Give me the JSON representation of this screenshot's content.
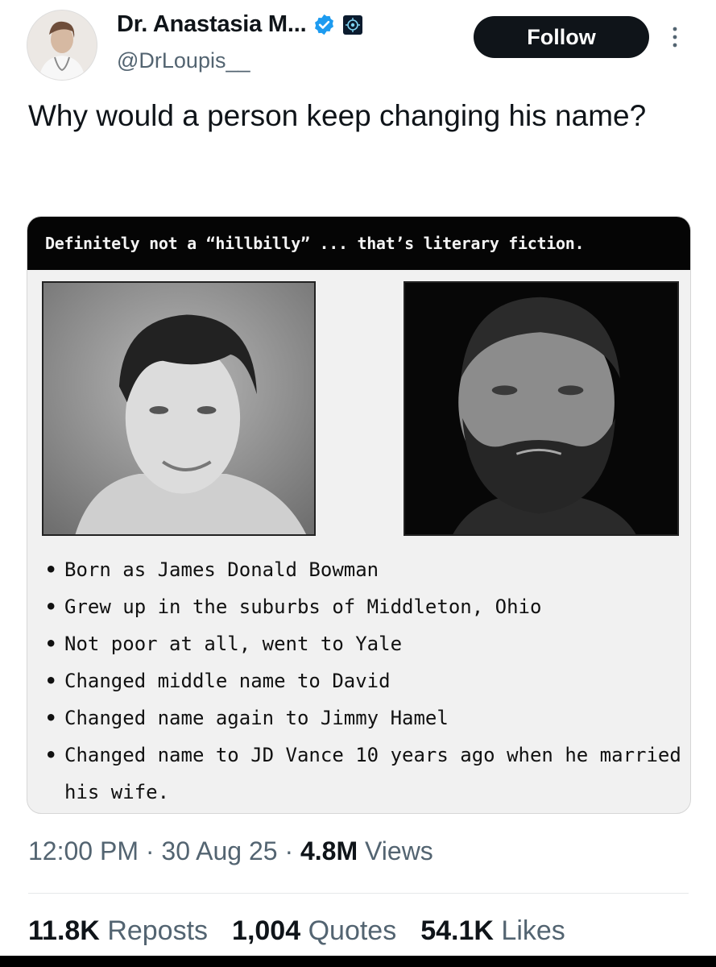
{
  "author": {
    "display_name": "Dr. Anastasia M...",
    "handle": "@DrLoupis__",
    "verified_icon": "verified-badge-icon",
    "affiliation_icon": "affiliation-badge-icon",
    "verified_color": "#1d9bf0"
  },
  "actions": {
    "follow_label": "Follow",
    "more_icon": "more-vertical-icon"
  },
  "tweet": {
    "text": "Why would a person keep changing his name?"
  },
  "media": {
    "banner": "Definitely not a “hillbilly” ... that’s literary fiction.",
    "facts": [
      "Born as James Donald Bowman",
      "Grew up in the suburbs of Middleton, Ohio",
      "Not poor at all, went to Yale",
      "Changed middle name to David",
      "Changed name again to Jimmy Hamel",
      "Changed name to JD Vance 10 years ago when he married his wife."
    ],
    "bullet": "•"
  },
  "meta": {
    "time": "12:00 PM",
    "sep": " · ",
    "date": "30 Aug 25",
    "views_count": "4.8M",
    "views_label": "Views"
  },
  "stats": {
    "reposts_count": "11.8K",
    "reposts_label": "Reposts",
    "quotes_count": "1,004",
    "quotes_label": "Quotes",
    "likes_count": "54.1K",
    "likes_label": "Likes"
  }
}
